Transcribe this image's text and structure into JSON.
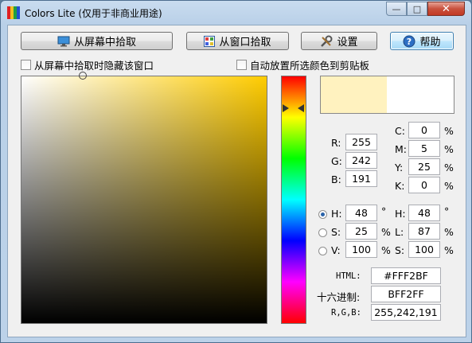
{
  "window": {
    "title": "Colors Lite (仅用于非商业用途)",
    "controls": {
      "minimize": "—",
      "maximize": "□",
      "close": "✕"
    },
    "icon_colors": [
      "#e02020",
      "#f0c020",
      "#20a040",
      "#2050d0"
    ]
  },
  "toolbar": {
    "pick_screen": "从屏幕中拾取",
    "pick_window": "从窗口拾取",
    "settings": "设置",
    "help": "帮助"
  },
  "options": {
    "hide_window": "从屏幕中拾取时隐藏该窗口",
    "auto_copy": "自动放置所选颜色到剪贴板"
  },
  "colors": {
    "current": "#FFF2BF",
    "previous": "#FFFFFF",
    "hue_base": "#FFCC00"
  },
  "rgb": {
    "r_label": "R:",
    "r": "255",
    "g_label": "G:",
    "g": "242",
    "b_label": "B:",
    "b": "191"
  },
  "cmyk": {
    "c_label": "C:",
    "c": "0",
    "m_label": "M:",
    "m": "5",
    "y_label": "Y:",
    "y": "25",
    "k_label": "K:",
    "k": "0",
    "unit": "%"
  },
  "hsv": {
    "h_label": "H:",
    "h": "48",
    "h_unit": "°",
    "s_label": "S:",
    "s": "25",
    "s_unit": "%",
    "v_label": "V:",
    "v": "100",
    "v_unit": "%",
    "selected": "H"
  },
  "hsl": {
    "h_label": "H:",
    "h": "48",
    "h_unit": "°",
    "l_label": "L:",
    "l": "87",
    "l_unit": "%",
    "s_label": "S:",
    "s": "100",
    "s_unit": "%"
  },
  "codes": {
    "html_label": "HTML:",
    "html": "#FFF2BF",
    "hex_label": "十六进制:",
    "hex": "BFF2FF",
    "rgb_label": "R,G,B:",
    "rgb": "255,242,191"
  }
}
